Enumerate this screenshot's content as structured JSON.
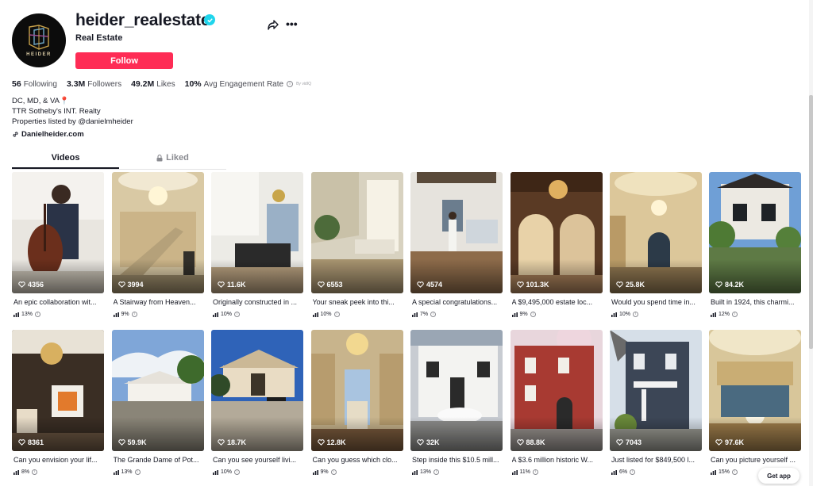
{
  "profile": {
    "username": "heider_realestate",
    "subtitle": "Real Estate",
    "avatar_text": "HEIDER",
    "follow_label": "Follow",
    "verified_icon": "verified-check-icon"
  },
  "stats": {
    "following_count": "56",
    "following_label": "Following",
    "followers_count": "3.3M",
    "followers_label": "Followers",
    "likes_count": "49.2M",
    "likes_label": "Likes",
    "engagement_value": "10%",
    "engagement_label": "Avg Engagement Rate",
    "engagement_source": "By vidIQ"
  },
  "bio": {
    "line1": "DC, MD, & VA📍",
    "line2": "TTR Sotheby's INT. Realty",
    "line3": "Properties listed by @danielmheider",
    "link": "Danielheider.com"
  },
  "tabs": {
    "videos": "Videos",
    "liked": "Liked"
  },
  "videos": [
    {
      "views": "4356",
      "caption": "An epic collaboration wit...",
      "engagement": "13%"
    },
    {
      "views": "3994",
      "caption": "A Stairway from Heaven...",
      "engagement": "9%"
    },
    {
      "views": "11.6K",
      "caption": "Originally constructed in ...",
      "engagement": "10%"
    },
    {
      "views": "6553",
      "caption": "Your sneak peek into thi...",
      "engagement": "10%"
    },
    {
      "views": "4574",
      "caption": "A special congratulations...",
      "engagement": "7%"
    },
    {
      "views": "101.3K",
      "caption": "A $9,495,000 estate loc...",
      "engagement": "9%"
    },
    {
      "views": "25.8K",
      "caption": "Would you spend time in...",
      "engagement": "10%"
    },
    {
      "views": "84.2K",
      "caption": "Built in 1924, this charmi...",
      "engagement": "12%"
    },
    {
      "views": "8361",
      "caption": "Can you envision your lif...",
      "engagement": "8%"
    },
    {
      "views": "59.9K",
      "caption": "The Grande Dame of Pot...",
      "engagement": "13%"
    },
    {
      "views": "18.7K",
      "caption": "Can you see yourself livi...",
      "engagement": "10%"
    },
    {
      "views": "12.8K",
      "caption": "Can you guess which clo...",
      "engagement": "9%"
    },
    {
      "views": "32K",
      "caption": "Step inside this $10.5 mill...",
      "engagement": "13%"
    },
    {
      "views": "88.8K",
      "caption": "A $3.6 million historic W...",
      "engagement": "11%"
    },
    {
      "views": "7043",
      "caption": "Just listed for $849,500 l...",
      "engagement": "6%"
    },
    {
      "views": "97.6K",
      "caption": "Can you picture yourself ...",
      "engagement": "15%"
    }
  ],
  "get_app_label": "Get app",
  "colors": {
    "accent": "#fe2c55",
    "verified": "#20d5ec",
    "text": "#161823"
  }
}
